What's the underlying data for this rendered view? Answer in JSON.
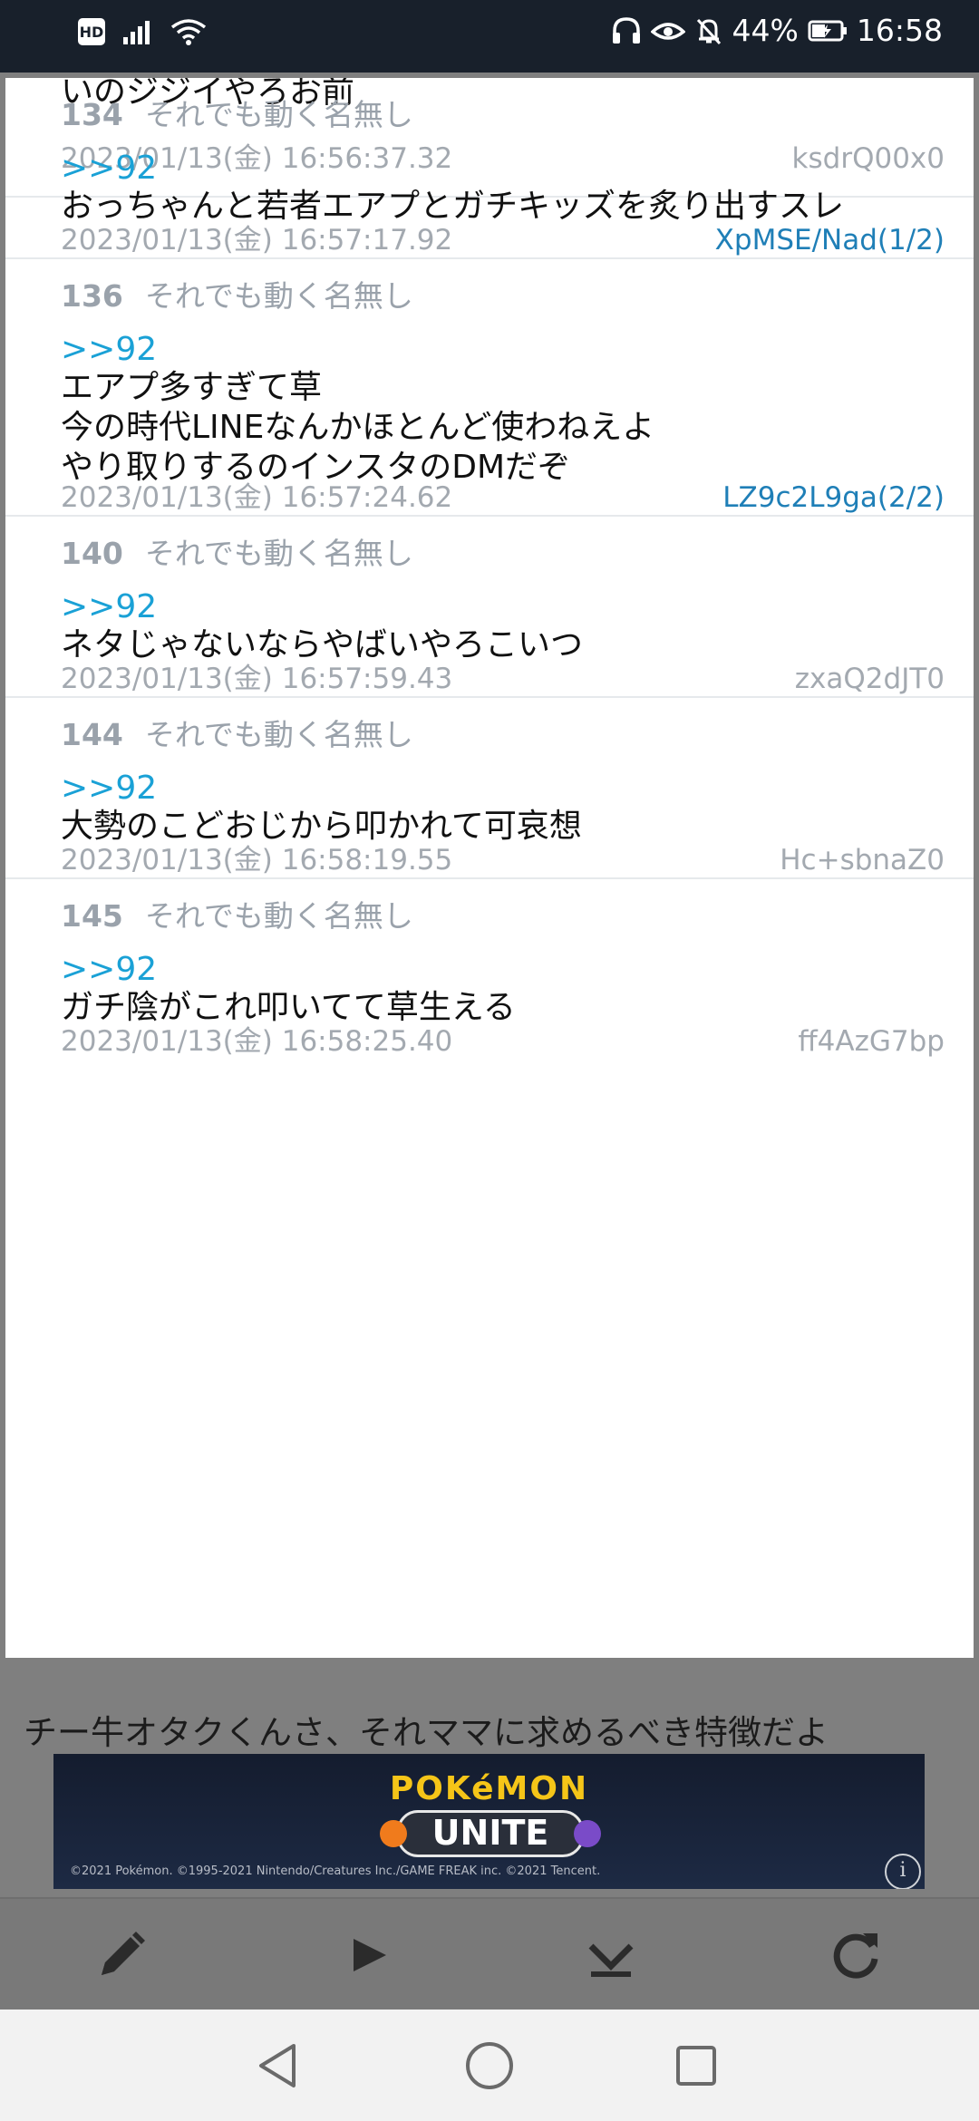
{
  "status_bar": {
    "hd_label": "HD",
    "battery_percent": "44%",
    "time": "16:58",
    "icons": [
      "signal-icon",
      "wifi-icon",
      "headphones-icon",
      "eye-icon",
      "bell-off-icon",
      "battery-charging-icon"
    ]
  },
  "thread": {
    "top_fragment": {
      "body": "いのジジイやろお前",
      "date": "2023/01/13(金) 16:56:37.32",
      "id": "ksdrQ00x0"
    },
    "posts": [
      {
        "number": "134",
        "name": "それでも動く名無し",
        "anchor": ">>92",
        "lines": [
          "おっちゃんと若者エアプとガチキッズを炙り出すスレ"
        ],
        "date": "2023/01/13(金) 16:57:17.92",
        "id": "XpMSE/Nad(1/2)",
        "id_is_link": true
      },
      {
        "number": "136",
        "name": "それでも動く名無し",
        "anchor": ">>92",
        "lines": [
          "エアプ多すぎて草",
          "今の時代LINEなんかほとんど使わねえよ",
          "やり取りするのインスタのDMだぞ"
        ],
        "date": "2023/01/13(金) 16:57:24.62",
        "id": "LZ9c2L9ga(2/2)",
        "id_is_link": true
      },
      {
        "number": "140",
        "name": "それでも動く名無し",
        "anchor": ">>92",
        "lines": [
          "ネタじゃないならやばいやろこいつ"
        ],
        "date": "2023/01/13(金) 16:57:59.43",
        "id": "zxaQ2dJT0",
        "id_is_link": false
      },
      {
        "number": "144",
        "name": "それでも動く名無し",
        "anchor": ">>92",
        "lines": [
          "大勢のこどおじから叩かれて可哀想"
        ],
        "date": "2023/01/13(金) 16:58:19.55",
        "id": "Hc+sbnaZ0",
        "id_is_link": false
      },
      {
        "number": "145",
        "name": "それでも動く名無し",
        "anchor": ">>92",
        "lines": [
          "ガチ陰がこれ叩いてて草生える"
        ],
        "date": "2023/01/13(金) 16:58:25.40",
        "id": "ff4AzG7bp",
        "id_is_link": false
      }
    ]
  },
  "background_text": "チー牛オタクくんさ、それママに求めるべき特徴だよ",
  "ad_banner": {
    "logo_top": "POKéMON",
    "logo_main": "UNITE",
    "copyright": "©2021 Pokémon. ©1995-2021 Nintendo/Creatures Inc./GAME FREAK inc. ©2021 Tencent.",
    "info_label": "i"
  },
  "toolbar": {
    "buttons": [
      "pencil-icon",
      "play-icon",
      "download-icon",
      "refresh-icon"
    ]
  },
  "nav_bar": {
    "buttons": [
      "back-triangle-icon",
      "home-circle-icon",
      "recents-square-icon"
    ]
  },
  "colors": {
    "status_bar_bg": "#18202b",
    "anchor_blue": "#1aa1d6",
    "id_link_blue": "#1f7fb7",
    "meta_gray": "#a3a9b0",
    "overlay_gray": "#7f7f7f"
  }
}
